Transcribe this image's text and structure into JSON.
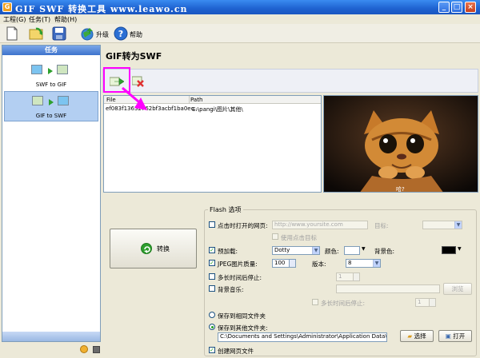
{
  "window": {
    "title": "GIF SWF 转换工具 www.leawo.cn",
    "minimize": "_",
    "maximize": "□",
    "close": "×"
  },
  "menu": {
    "project": "工程(G)",
    "task": "任务(T)",
    "help": "帮助(H)"
  },
  "toolbar": {
    "upgrade": "升级",
    "help": "帮助"
  },
  "sidebar": {
    "header": "任务",
    "items": [
      {
        "label": "SWF to GIF",
        "selected": false
      },
      {
        "label": "GIF to SWF",
        "selected": true
      }
    ]
  },
  "main": {
    "title": "GIF转为SWF",
    "filelist": {
      "columns": [
        "File",
        "Path"
      ],
      "rows": [
        {
          "file": "ef083f13632762bf3acbf1ba0ec...",
          "path": "E:\\pangi\\图片\\其他\\"
        }
      ]
    },
    "preview_caption": "哈?",
    "convert_label": "转换"
  },
  "flash_options": {
    "title": "Flash 选项",
    "open_url_label": "点击时打开的网页:",
    "url_placeholder": "http://www.yoursite.com",
    "target_label": "目标:",
    "use_click_target": "使用点击目标",
    "preload_label": "预加载:",
    "preload_value": "Dotty",
    "color_label": "颜色:",
    "bgcolor_label": "背景色:",
    "bgcolor_value": "#000000",
    "jpeg_label": "JPEG图片质量:",
    "jpeg_value": "100",
    "version_label": "版本:",
    "version_value": "8",
    "stop_after_label": "多长时间后停止:",
    "stop_after_value": "1",
    "bgmusic_label": "背景音乐:",
    "browse_label": "浏览",
    "music_stop_label": "多长时间后停止:",
    "music_stop_value": "1",
    "save_same_folder": "保存到相同文件夹",
    "save_other_folder": "保存到其他文件夹:",
    "folder_path": "C:\\Documents and Settings\\Administrator\\Application Data\\A",
    "select_label": "选择",
    "open_label": "打开",
    "create_webpage": "创建网页文件"
  },
  "colors": {
    "titlebar": "#1E62D0",
    "highlight": "#FF00FF",
    "accent": "#21A121"
  }
}
